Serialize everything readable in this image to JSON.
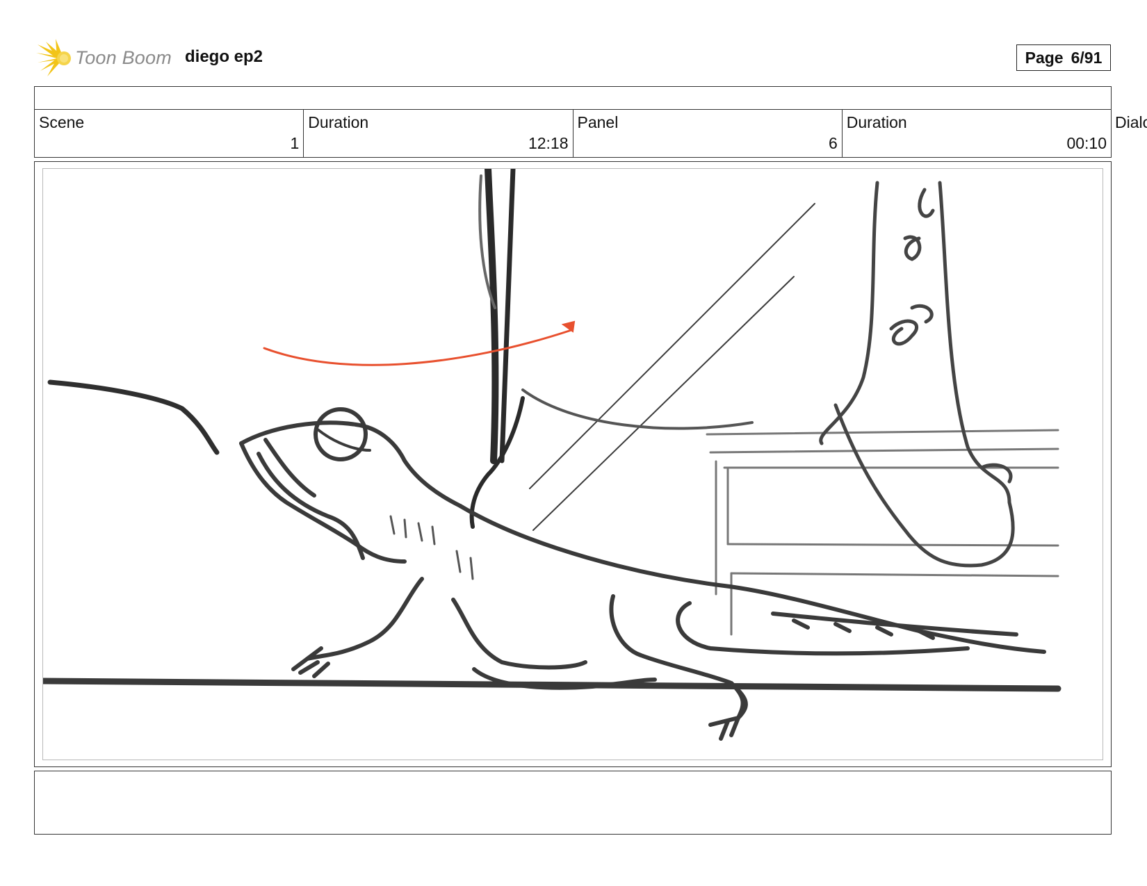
{
  "header": {
    "logo_text": "Toon Boom",
    "project_title": "diego ep2",
    "page_label": "Page",
    "page_number": "6/91"
  },
  "info": {
    "scene_label": "Scene",
    "scene_value": "1",
    "scene_duration_label": "Duration",
    "scene_duration_value": "12:18",
    "panel_label": "Panel",
    "panel_value": "6",
    "panel_duration_label": "Duration",
    "panel_duration_value": "00:10",
    "overflow_label": "Dialo"
  },
  "colors": {
    "logo_accent": "#f2c418",
    "sketch_ink": "#333333",
    "motion_arrow": "#e8502e"
  },
  "icons": {
    "logo": "sunburst-logo-icon"
  }
}
